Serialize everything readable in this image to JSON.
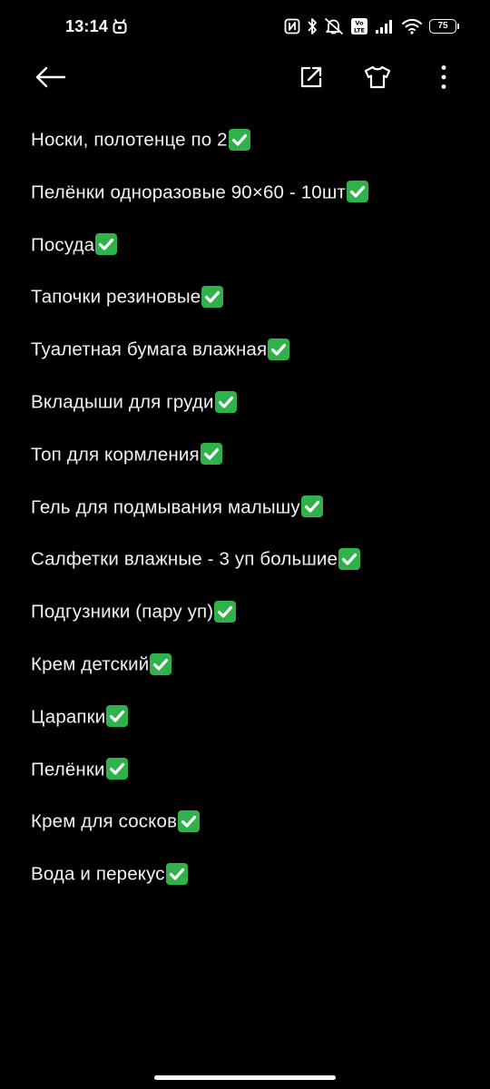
{
  "status_bar": {
    "time": "13:14",
    "battery_level": "75",
    "icons": [
      "nfc-icon",
      "bluetooth-icon",
      "mute-icon",
      "volte-icon",
      "signal-icon",
      "wifi-icon",
      "battery-icon"
    ]
  },
  "app_bar": {
    "icons": [
      "back-arrow-icon",
      "share-icon",
      "theme-shirt-icon",
      "more-vert-icon"
    ]
  },
  "note": {
    "lines": [
      {
        "text": "Носки, полотенце по 2",
        "checked": true
      },
      {
        "text": "Пелёнки одноразовые 90×60 - 10шт",
        "checked": true
      },
      {
        "text": "Посуда",
        "checked": true
      },
      {
        "text": "Тапочки резиновые",
        "checked": true
      },
      {
        "text": "Туалетная бумага влажная",
        "checked": true
      },
      {
        "text": "Вкладыши для груди",
        "checked": true
      },
      {
        "text": "Топ для кормления",
        "checked": true
      },
      {
        "text": "Гель для подмывания малышу",
        "checked": true
      },
      {
        "text": "Салфетки влажные - 3 уп большие",
        "checked": true
      },
      {
        "text": "Подгузники (пару уп)",
        "checked": true
      },
      {
        "text": "Крем детский",
        "checked": true
      },
      {
        "text": "Царапки",
        "checked": true
      },
      {
        "text": "Пелёнки",
        "checked": true
      },
      {
        "text": "Крем для сосков",
        "checked": true
      },
      {
        "text": "Вода и перекус",
        "checked": true
      }
    ]
  },
  "colors": {
    "background": "#000000",
    "text": "#f2f2f2",
    "check": "#2fb24a"
  }
}
